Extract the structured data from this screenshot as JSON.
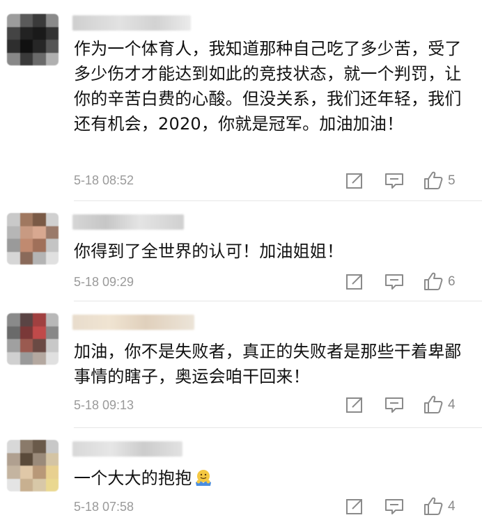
{
  "comments": [
    {
      "text": "作为一个体育人，我知道那种自己吃了多少苦，受了多少伤才才能达到如此的竞技状态，就一个判罚，让你的辛苦白费的心酸。但没关系，我们还年轻，我们还有机会，2020，你就是冠军。加油加油！",
      "time": "5-18 08:52",
      "likes": "5"
    },
    {
      "text": "你得到了全世界的认可！加油姐姐！",
      "time": "5-18 09:29",
      "likes": "6"
    },
    {
      "text": "加油，你不是失败者，真正的失败者是那些干着卑鄙事情的瞎子，奥运会咱干回来！",
      "time": "5-18 09:13",
      "likes": "4"
    },
    {
      "text": "一个大大的抱抱",
      "time": "5-18 07:58",
      "likes": "4",
      "emoji": "hug-emoji"
    }
  ],
  "icons": {
    "share": "share-icon",
    "comment": "comment-icon",
    "like": "thumbs-up-icon"
  },
  "colors": {
    "time": "#9a9a9a",
    "icon": "#8a8a8a",
    "divider": "#e6e6e6"
  }
}
